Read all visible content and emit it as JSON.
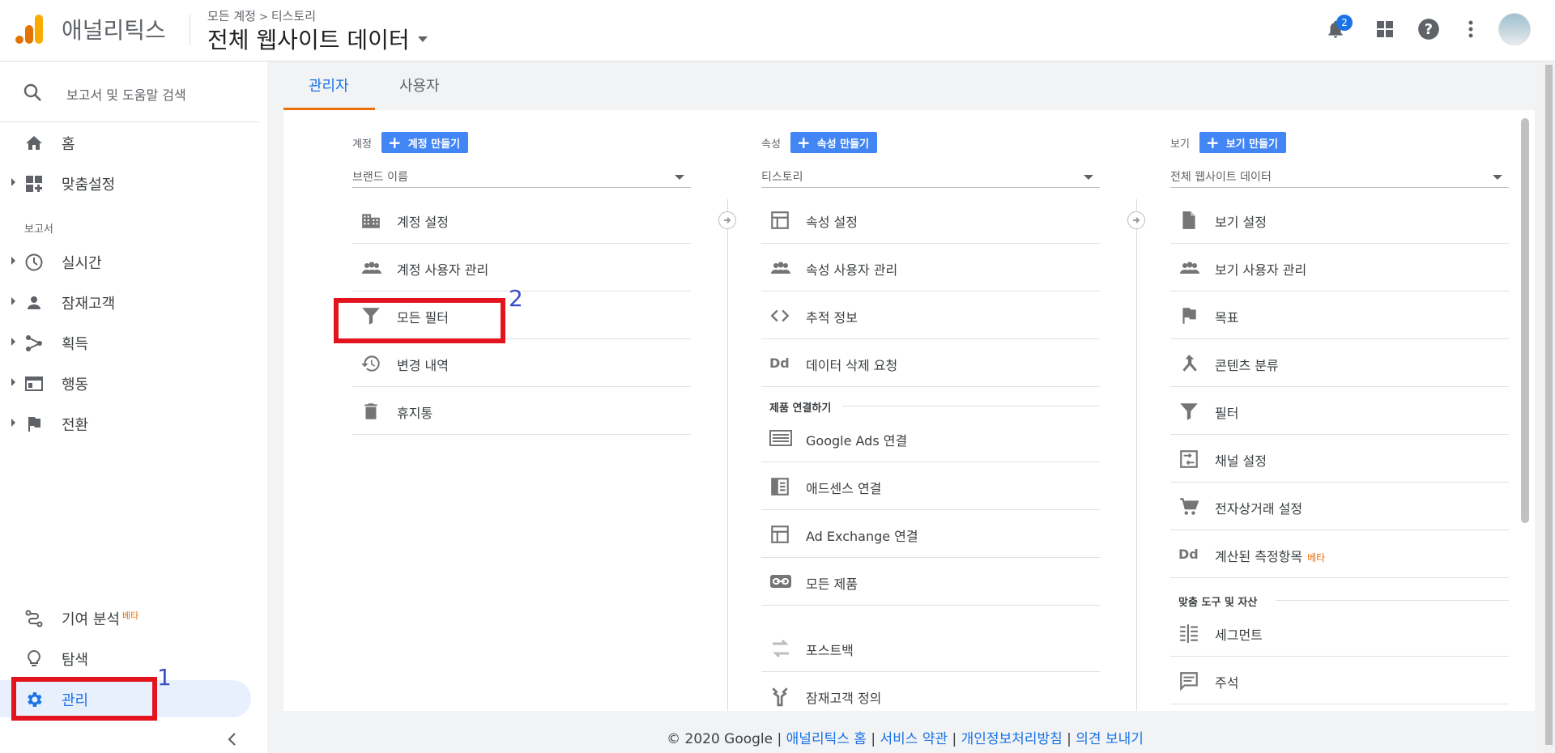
{
  "header": {
    "app_name": "애널리틱스",
    "breadcrumb_account": "모든 계정",
    "breadcrumb_property": "티스토리",
    "view_title": "전체 웹사이트 데이터",
    "notification_count": "2"
  },
  "sidebar": {
    "search_label": "보고서 및 도움말 검색",
    "items_top": [
      {
        "label": "홈"
      },
      {
        "label": "맞춤설정"
      }
    ],
    "reports_section": "보고서",
    "reports": [
      {
        "label": "실시간"
      },
      {
        "label": "잠재고객"
      },
      {
        "label": "획득"
      },
      {
        "label": "행동"
      },
      {
        "label": "전환"
      }
    ],
    "bottom": [
      {
        "label": "기여 분석",
        "beta": "베타"
      },
      {
        "label": "탐색"
      },
      {
        "label": "관리"
      }
    ]
  },
  "annotations": {
    "one": "1",
    "two": "2"
  },
  "tabs": {
    "admin": "관리자",
    "user": "사용자"
  },
  "account": {
    "label": "계정",
    "create": "계정 만들기",
    "select": "브랜드 이름",
    "items": [
      "계정 설정",
      "계정 사용자 관리",
      "모든 필터",
      "변경 내역",
      "휴지통"
    ]
  },
  "property": {
    "label": "속성",
    "create": "속성 만들기",
    "select": "티스토리",
    "items": [
      "속성 설정",
      "속성 사용자 관리",
      "추적 정보",
      "데이터 삭제 요청"
    ],
    "dd_label": "Dd",
    "links_heading": "제품 연결하기",
    "links": [
      "Google Ads 연결",
      "애드센스 연결",
      "Ad Exchange 연결",
      "모든 제품"
    ],
    "extra": [
      "포스트백",
      "잠재고객 정의"
    ]
  },
  "view": {
    "label": "보기",
    "create": "보기 만들기",
    "select": "전체 웹사이트 데이터",
    "items": [
      "보기 설정",
      "보기 사용자 관리",
      "목표",
      "콘텐츠 분류",
      "필터",
      "채널 설정",
      "전자상거래 설정",
      "계산된 측정항목"
    ],
    "beta": "베타",
    "dd_label": "Dd",
    "tools_heading": "맞춤 도구 및 자산",
    "tools": [
      "세그먼트",
      "주석"
    ]
  },
  "footer": {
    "copyright": "© 2020 Google",
    "sep": "|",
    "links": [
      "애널리틱스 홈",
      "서비스 약관",
      "개인정보처리방침",
      "의견 보내기"
    ]
  },
  "colors": {
    "accent": "#1a73e8",
    "button": "#4285f4",
    "annotation": "#e3141e",
    "tab_underline": "#e8710a"
  }
}
